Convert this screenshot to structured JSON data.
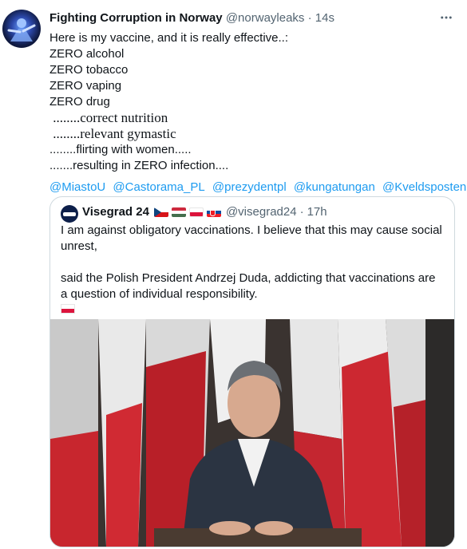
{
  "tweet": {
    "author_name": "Fighting Corruption in Norway",
    "handle": "@norwayleaks",
    "separator": "·",
    "time": "14s",
    "lines": [
      "Here is my vaccine, and it is really effective..:",
      "ZERO alcohol",
      "ZERO tobacco",
      "ZERO vaping",
      "ZERO drug"
    ],
    "serif_lines": [
      " ........correct nutrition",
      " ........relevant gymastic"
    ],
    "tail_lines": [
      "........flirting with women.....",
      ".......resulting in ZERO infection...."
    ],
    "mentions": [
      "@MiastoU",
      "@Castorama_PL",
      "@prezydentpl",
      "@kungatungan",
      "@Kveldsposten"
    ]
  },
  "quote": {
    "author_name": "Visegrad 24",
    "flags": [
      "cz",
      "hu",
      "pl",
      "sk"
    ],
    "handle": "@visegrad24",
    "separator": "·",
    "time": "17h",
    "paragraph1": "I am against obligatory vaccinations. I believe that this may cause social unrest,",
    "paragraph2": "said the Polish President Andrzej Duda, addicting that vaccinations are a question of individual responsibility.",
    "trailing_flag": "pl"
  },
  "icons": {
    "more": "more-horizontal-icon"
  },
  "colors": {
    "link": "#1d9bf0",
    "muted": "#536471",
    "text": "#0f1419",
    "border": "#cfd9de"
  }
}
